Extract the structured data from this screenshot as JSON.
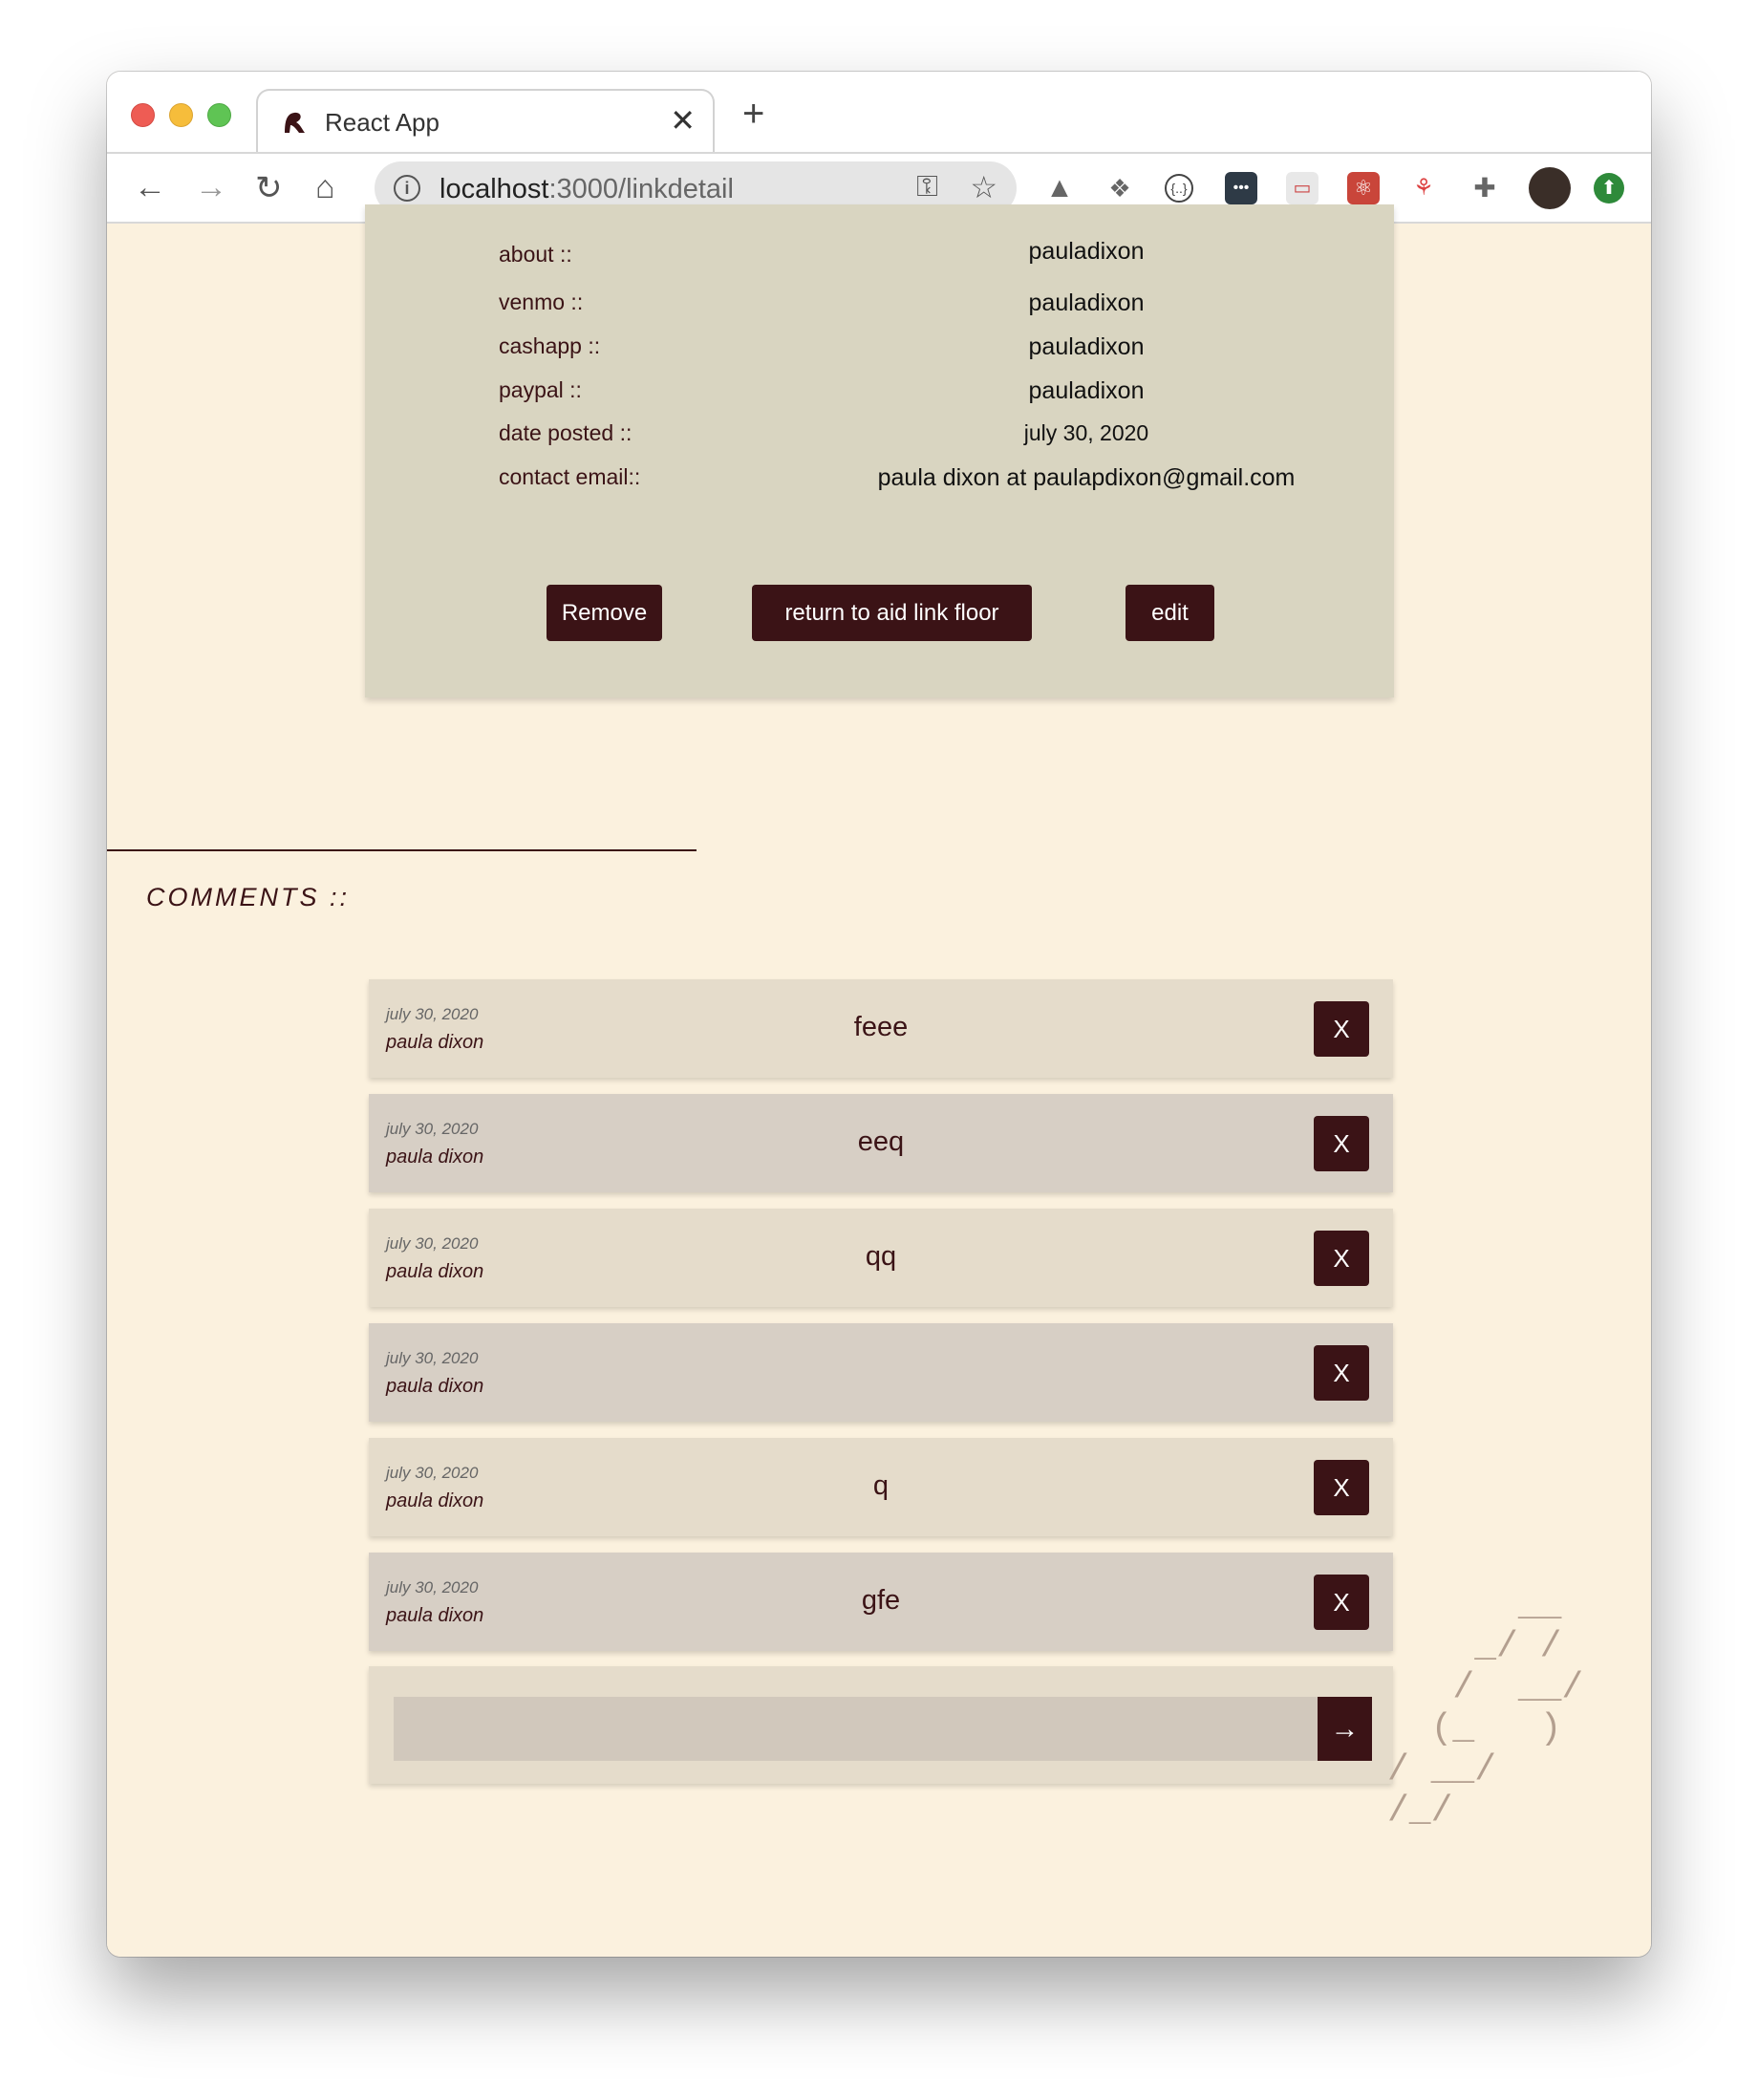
{
  "browser": {
    "tab_title": "React App",
    "tab_close": "✕",
    "new_tab": "+",
    "url_host": "localhost",
    "url_path": ":3000/linkdetail",
    "nav": {
      "back": "←",
      "forward": "→",
      "reload": "↻",
      "home": "⌂"
    }
  },
  "detail": {
    "rows": [
      {
        "label": "about ::",
        "value": "pauladixon"
      },
      {
        "label": "venmo ::",
        "value": "pauladixon"
      },
      {
        "label": "cashapp ::",
        "value": "pauladixon"
      },
      {
        "label": "paypal ::",
        "value": "pauladixon"
      },
      {
        "label": "date posted ::",
        "value": "july 30, 2020"
      },
      {
        "label": "contact email::",
        "value": "paula dixon at paulapdixon@gmail.com"
      }
    ],
    "buttons": {
      "remove": "Remove",
      "return": "return to aid link floor",
      "edit": "edit"
    }
  },
  "comments": {
    "heading": "COMMENTS ::",
    "items": [
      {
        "date": "july 30, 2020",
        "author": "paula dixon",
        "text": "feee",
        "delete": "X"
      },
      {
        "date": "july 30, 2020",
        "author": "paula dixon",
        "text": "eeq",
        "delete": "X"
      },
      {
        "date": "july 30, 2020",
        "author": "paula dixon",
        "text": "qq",
        "delete": "X"
      },
      {
        "date": "july 30, 2020",
        "author": "paula dixon",
        "text": "",
        "delete": "X"
      },
      {
        "date": "july 30, 2020",
        "author": "paula dixon",
        "text": "q",
        "delete": "X"
      },
      {
        "date": "july 30, 2020",
        "author": "paula dixon",
        "text": "gfe",
        "delete": "X"
      }
    ],
    "input_value": "",
    "submit": "→"
  },
  "decor": {
    "ascii": "      __\n    _/ /\n   /  __/\n  (_   )\n/ __/\n/_/"
  },
  "colors": {
    "accent": "#3b1316",
    "page_bg": "#fbf1de",
    "card_bg": "#d9d5c1"
  }
}
